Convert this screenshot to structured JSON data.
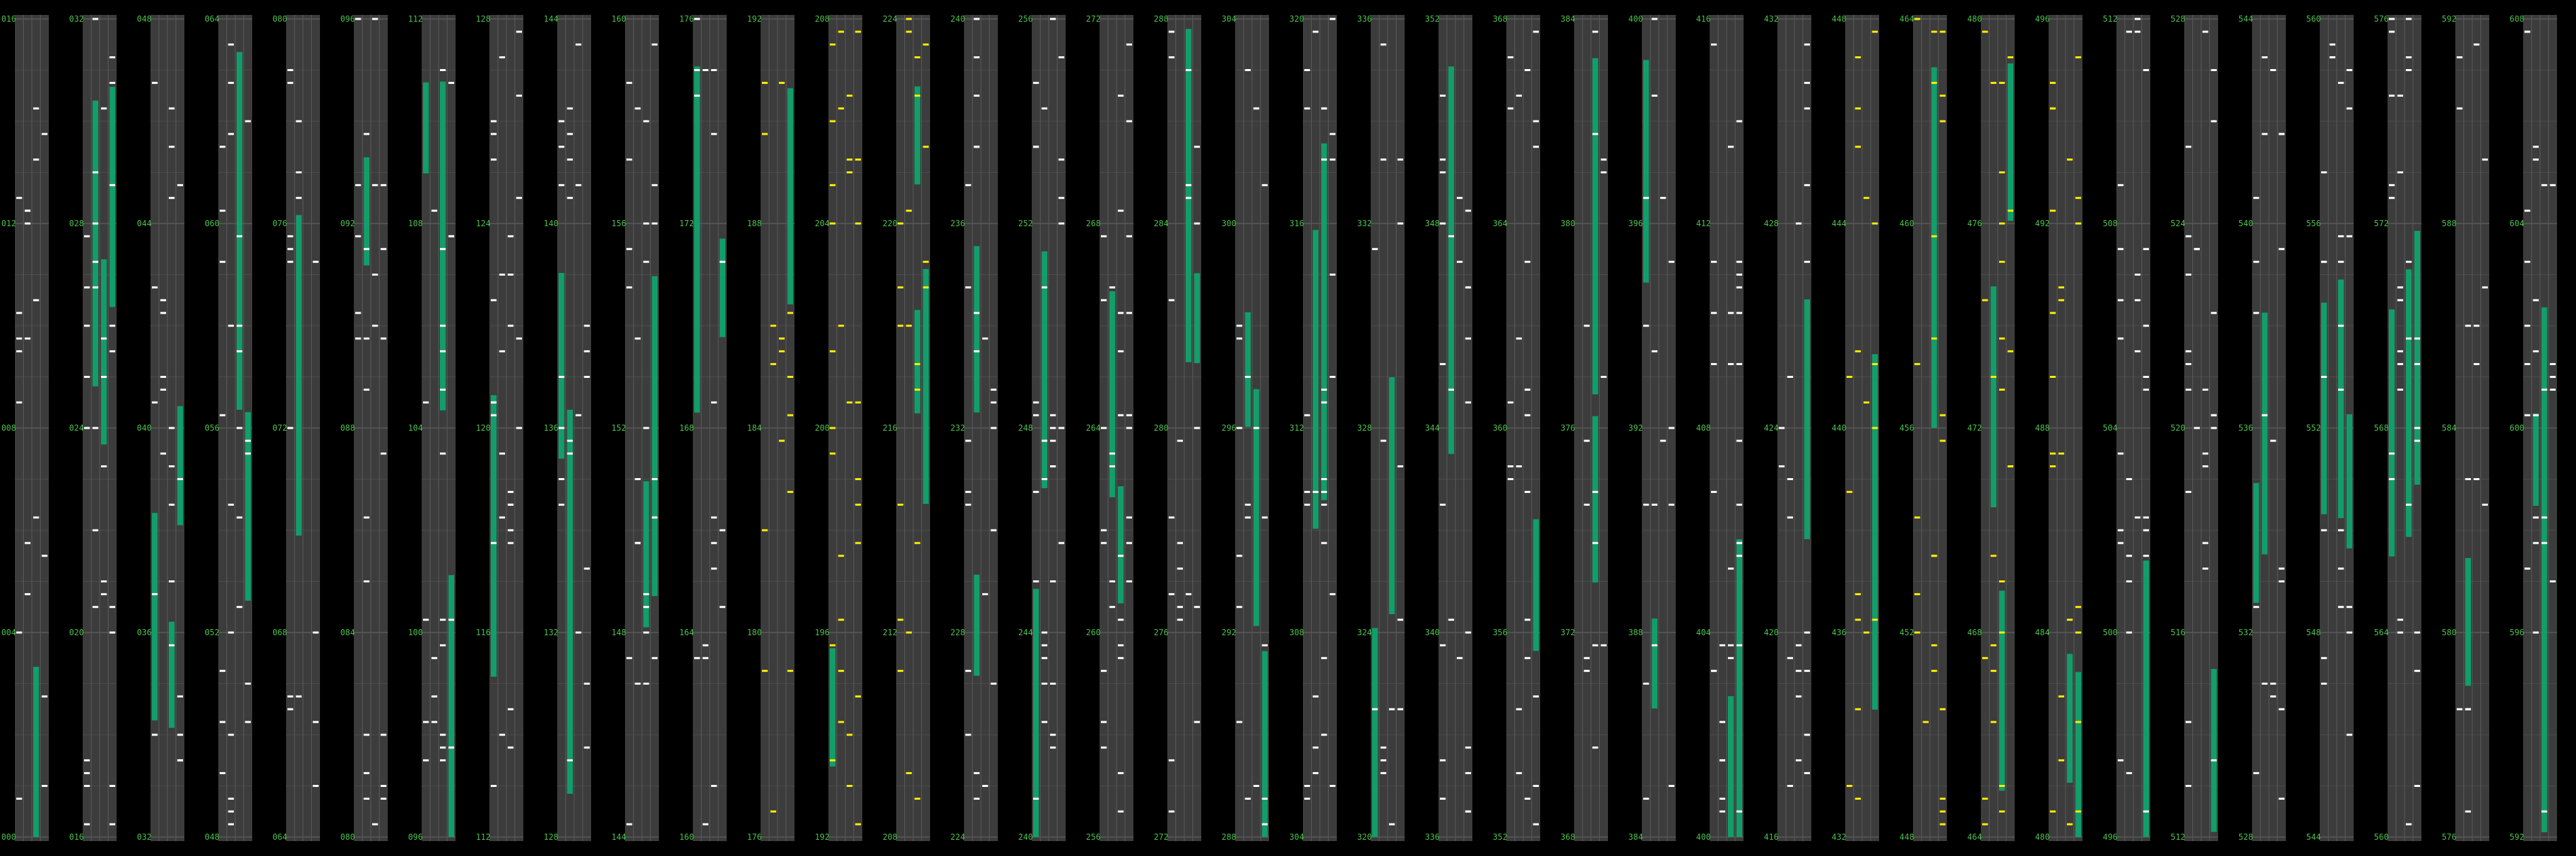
{
  "colors": {
    "background": "#000000",
    "lane": "#3c3c3c",
    "grid": "#5a5a5a",
    "hold_note": "#129e6a",
    "tap_note": "#ffffff",
    "mine_note": "#ffee00",
    "tick_label": "#4cc24c"
  },
  "chart_data": {
    "type": "table",
    "title": "",
    "description_kind": "rhythm-game note chart, columns of measures, 4 lanes each",
    "measures_per_column": 4,
    "columns": 38,
    "measure_labels_top": [
      "016",
      "032",
      "048",
      "064",
      "080",
      "096",
      "112",
      "128",
      "144",
      "160",
      "176",
      "192",
      "208",
      "224",
      "240",
      "256",
      "272",
      "288",
      "304",
      "320",
      "336",
      "352",
      "368",
      "384",
      "400",
      "416",
      "432",
      "448",
      "464",
      "480",
      "496",
      "512",
      "528",
      "544",
      "560",
      "576",
      "592",
      "608"
    ],
    "measure_labels_12": [
      "012",
      "028",
      "044",
      "060",
      "076",
      "092",
      "108",
      "124",
      "140",
      "156",
      "172",
      "188",
      "204",
      "220",
      "236",
      "252",
      "268",
      "284",
      "300",
      "316",
      "332",
      "348",
      "364",
      "380",
      "396",
      "412",
      "428",
      "444",
      "460",
      "476",
      "492",
      "508",
      "524",
      "540",
      "556",
      "572",
      "588",
      "604"
    ],
    "measure_labels_8": [
      "008",
      "024",
      "040",
      "056",
      "072",
      "088",
      "104",
      "120",
      "136",
      "152",
      "168",
      "184",
      "200",
      "216",
      "232",
      "248",
      "264",
      "280",
      "296",
      "312",
      "328",
      "344",
      "360",
      "376",
      "392",
      "408",
      "424",
      "440",
      "456",
      "472",
      "488",
      "504",
      "520",
      "536",
      "552",
      "568",
      "584",
      "600"
    ],
    "measure_labels_4": [
      "004",
      "020",
      "036",
      "052",
      "068",
      "084",
      "100",
      "116",
      "132",
      "148",
      "164",
      "180",
      "196",
      "212",
      "228",
      "244",
      "260",
      "276",
      "292",
      "308",
      "324",
      "340",
      "356",
      "372",
      "388",
      "404",
      "420",
      "436",
      "452",
      "468",
      "484",
      "500",
      "516",
      "532",
      "548",
      "564",
      "580",
      "596"
    ],
    "measure_labels_bottom": [
      "000",
      "016",
      "032",
      "048",
      "064",
      "080",
      "096",
      "112",
      "128",
      "144",
      "160",
      "176",
      "192",
      "208",
      "224",
      "240",
      "256",
      "272",
      "288",
      "304",
      "320",
      "336",
      "352",
      "368",
      "384",
      "400",
      "416",
      "432",
      "448",
      "464",
      "480",
      "496",
      "512",
      "528",
      "544",
      "560",
      "576",
      "592"
    ],
    "note_kinds": [
      "hold",
      "tap",
      "mine"
    ]
  }
}
